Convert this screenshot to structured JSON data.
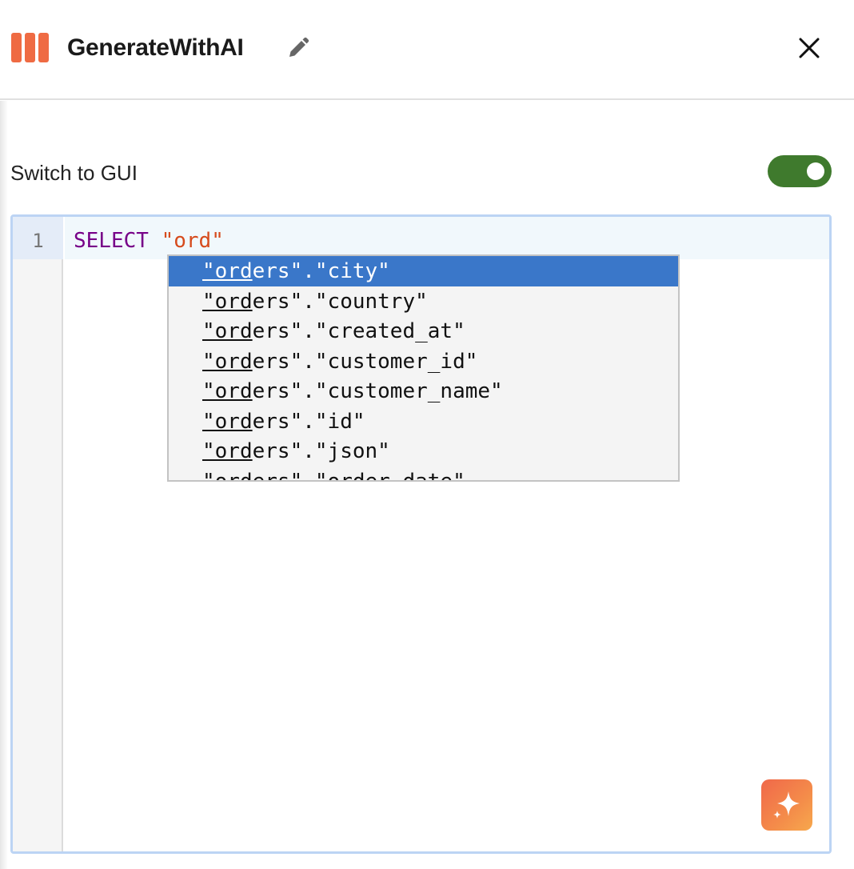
{
  "header": {
    "title": "GenerateWithAI",
    "icons": {
      "logo": "bars-logo-icon",
      "edit": "pencil-icon",
      "close": "close-icon"
    },
    "brand_color": "#ef6b43"
  },
  "switch": {
    "label": "Switch to GUI",
    "state": "on",
    "color": "#3f7a2d"
  },
  "editor": {
    "line_number": "1",
    "code": {
      "keyword": "SELECT",
      "string": "\"ord\""
    },
    "keyword_color": "#770088",
    "string_color": "#d64b1d"
  },
  "autocomplete": {
    "typed_prefix": "\"ord",
    "selected_index": 0,
    "selected_color": "#3a77c9",
    "items": [
      {
        "prefix": "\"ord",
        "rest": "ers\".\"city\""
      },
      {
        "prefix": "\"ord",
        "rest": "ers\".\"country\""
      },
      {
        "prefix": "\"ord",
        "rest": "ers\".\"created_at\""
      },
      {
        "prefix": "\"ord",
        "rest": "ers\".\"customer_id\""
      },
      {
        "prefix": "\"ord",
        "rest": "ers\".\"customer_name\""
      },
      {
        "prefix": "\"ord",
        "rest": "ers\".\"id\""
      },
      {
        "prefix": "\"ord",
        "rest": "ers\".\"json\""
      },
      {
        "prefix": "\"ord",
        "rest": "ers\".\"order_date\""
      }
    ]
  },
  "ai_button": {
    "icon": "sparkle-icon"
  }
}
